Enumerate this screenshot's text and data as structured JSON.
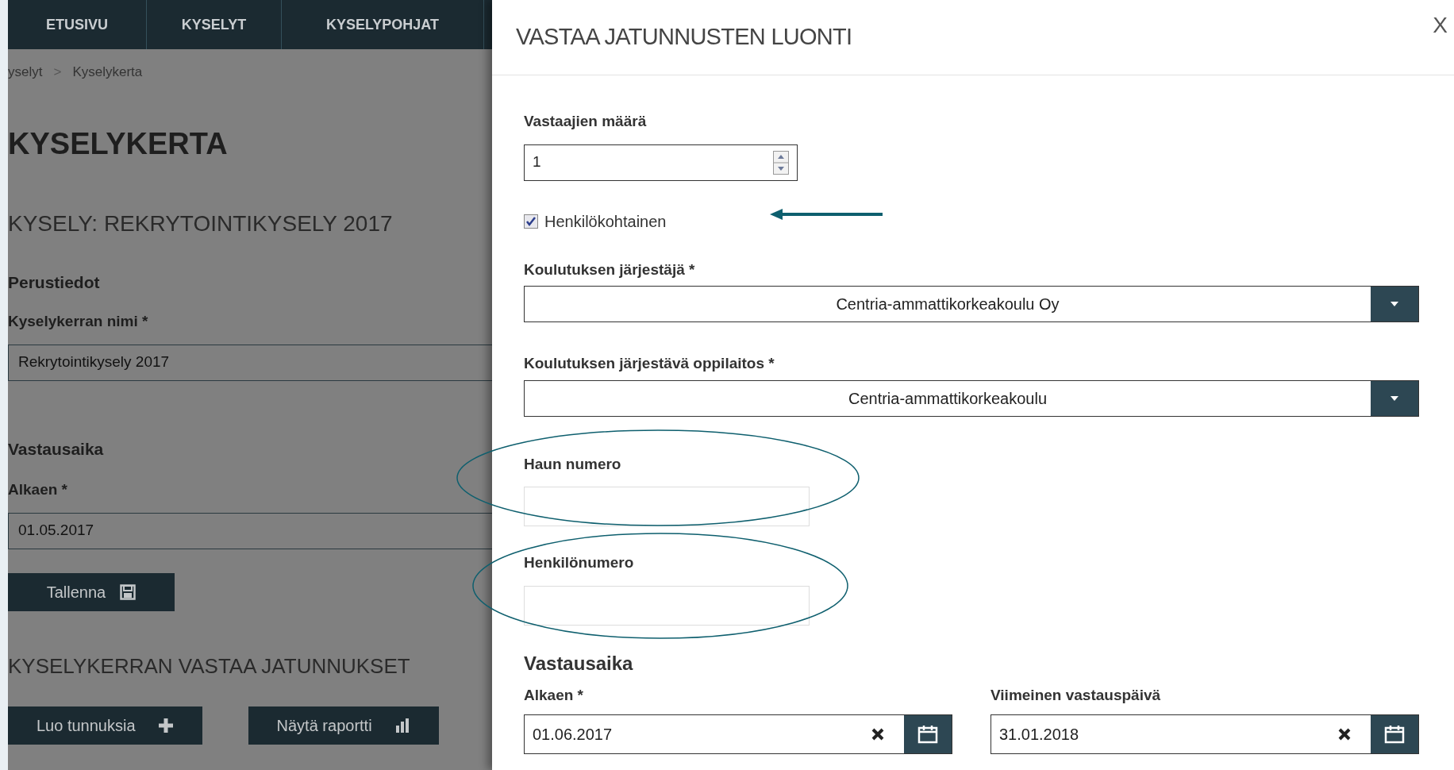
{
  "background_page": {
    "nav_tabs": [
      {
        "label": "ETUSIVU"
      },
      {
        "label": "KYSELYT"
      },
      {
        "label": "KYSELYPOHJAT"
      }
    ],
    "breadcrumb": {
      "items": [
        "yselyt",
        "Kyselykerta"
      ],
      "separator": ">"
    },
    "page_title": "KYSELYKERTA",
    "survey_title": "KYSELY: REKRYTOINTIKYSELY 2017",
    "basic_info": {
      "heading": "Perustiedot",
      "label": "Kyselykerran nimi *",
      "value": "Rekrytointikysely 2017"
    },
    "response_time": {
      "heading": "Vastausaika",
      "label": "Alkaen *",
      "value": "01.05.2017"
    },
    "save_button": "Tallenna",
    "codes_heading": "KYSELYKERRAN VASTAA JATUNNUKSET",
    "buttons": [
      {
        "label": "Luo tunnuksia",
        "kind": "create"
      },
      {
        "label": "Näytä raportti",
        "kind": "report"
      }
    ]
  },
  "modal": {
    "title": "VASTAA JATUNNUSTEN LUONTI",
    "close": "X",
    "fields": [
      {
        "kind": "number",
        "label": "Vastaajien määrä",
        "value": "1"
      },
      {
        "kind": "checkbox",
        "label": "Henkilökohtainen",
        "checked": true
      },
      {
        "kind": "select",
        "label": "Koulutuksen järjestäjä *",
        "value": "Centria-ammattikorkeakoulu Oy"
      },
      {
        "kind": "select",
        "label": "Koulutuksen järjestävä oppilaitos *",
        "value": "Centria-ammattikorkeakoulu"
      },
      {
        "kind": "text",
        "label": "Haun numero"
      },
      {
        "kind": "text",
        "label": "Henkilönumero"
      }
    ],
    "response_time": {
      "heading": "Vastausaika",
      "dates": [
        {
          "label": "Alkaen *",
          "value": "01.06.2017"
        },
        {
          "label": "Viimeinen vastauspäivä",
          "value": "31.01.2018"
        }
      ]
    }
  }
}
